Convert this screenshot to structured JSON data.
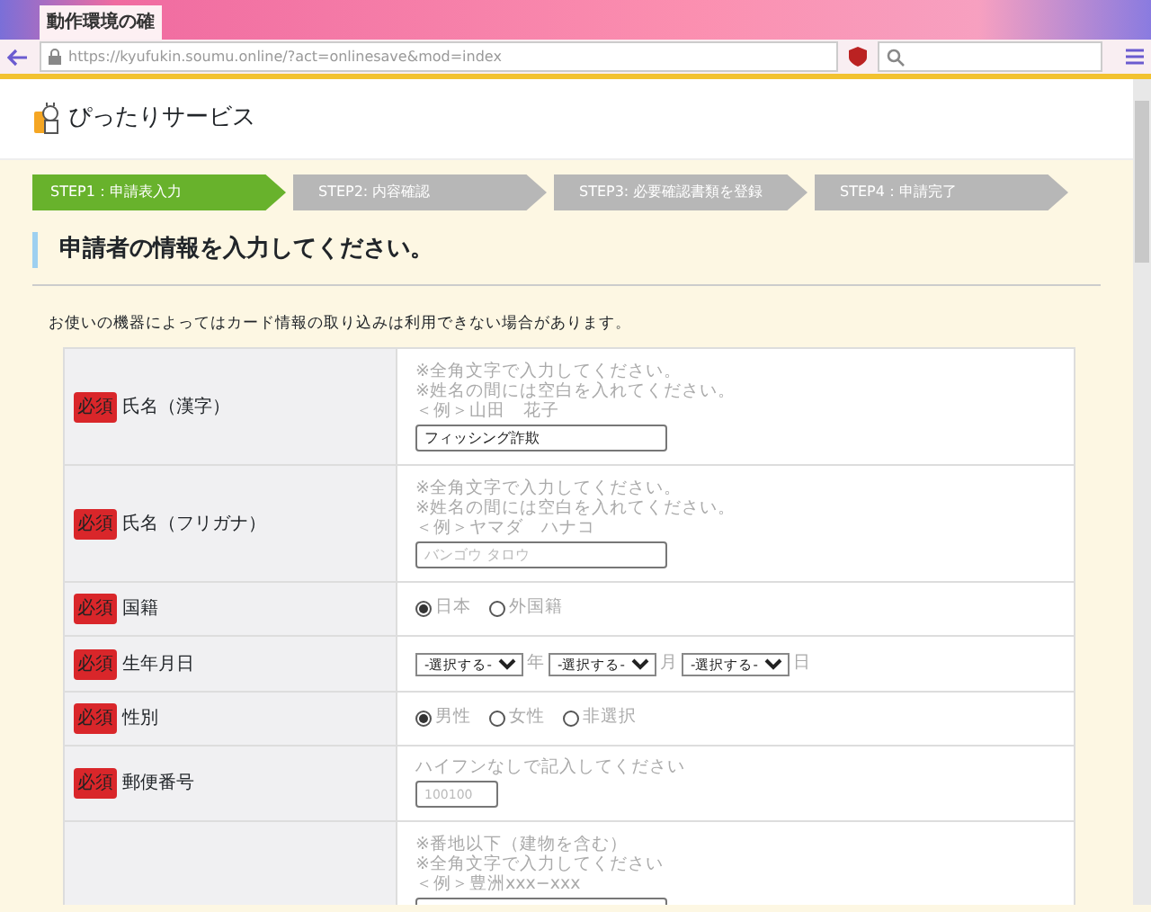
{
  "browser": {
    "tab_title": "動作環境の確",
    "url": "https://kyufukin.soumu.online/?act=onlinesave&mod=index"
  },
  "site": {
    "title": "ぴったりサービス"
  },
  "steps": [
    {
      "label": "STEP1：申請表入力",
      "selected": true
    },
    {
      "label": "STEP2: 内容確認",
      "selected": false
    },
    {
      "label": "STEP3:  必要確認書類を登録",
      "selected": false
    },
    {
      "label": "STEP4：申請完了",
      "selected": false
    }
  ],
  "heading": "申請者の情報を入力してください。",
  "notice": "お使いの機器によってはカード情報の取り込みは利用できない場合があります。",
  "form_rows": [
    {
      "kind": "text",
      "badge": "必須",
      "label": "氏名（漢字）",
      "hints": [
        "※全角文字で入力してください。",
        "※姓名の間には空白を入れてください。",
        "＜例＞山田　花子"
      ],
      "value": "フィッシング詐欺"
    },
    {
      "kind": "text",
      "badge": "必須",
      "label": "氏名（フリガナ）",
      "hints": [
        "※全角文字で入力してください。",
        "※姓名の間には空白を入れてください。",
        "＜例＞ヤマダ　ハナコ"
      ],
      "placeholder": "バンゴウ タロウ"
    },
    {
      "kind": "radio",
      "badge": "必須",
      "label": "国籍",
      "options": [
        {
          "label": "日本",
          "selected": true
        },
        {
          "label": "外国籍",
          "selected": false
        }
      ]
    },
    {
      "kind": "date",
      "badge": "必須",
      "label": "生年月日",
      "selects": [
        {
          "value": "-選択する-",
          "unit": "年"
        },
        {
          "value": "-選択する-",
          "unit": "月"
        },
        {
          "value": "-選択する-",
          "unit": "日"
        }
      ]
    },
    {
      "kind": "radio",
      "badge": "必須",
      "label": "性別",
      "options": [
        {
          "label": "男性",
          "selected": true
        },
        {
          "label": "女性",
          "selected": false
        },
        {
          "label": "非選択",
          "selected": false
        }
      ]
    },
    {
      "kind": "short",
      "badge": "必須",
      "label": "郵便番号",
      "hints": [
        "ハイフンなしで記入してください"
      ],
      "placeholder": "100100"
    },
    {
      "kind": "text",
      "hints": [
        "※番地以下（建物を含む）",
        "※全角文字で入力してください",
        "＜例＞豊洲xxx−xxx"
      ]
    }
  ]
}
